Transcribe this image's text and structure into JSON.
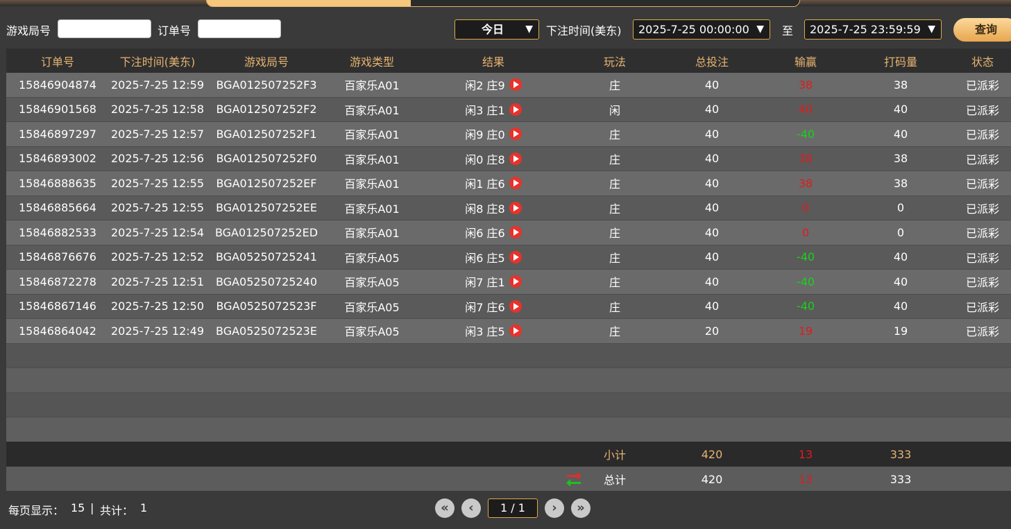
{
  "filter": {
    "round_label": "游戏局号",
    "round_value": "",
    "order_label": "订单号",
    "order_value": "",
    "range_value": "今日",
    "bet_time_label": "下注时间(美东)",
    "start_time": "2025-7-25 00:00:00",
    "to_label": "至",
    "end_time": "2025-7-25 23:59:59",
    "query_label": "查询"
  },
  "table": {
    "headers": [
      "订单号",
      "下注时间(美东)",
      "游戏局号",
      "游戏类型",
      "结果",
      "玩法",
      "总投注",
      "输赢",
      "打码量",
      "状态"
    ],
    "rows": [
      {
        "order": "15846904874",
        "time": "2025-7-25 12:59",
        "round": "BGA012507252F3",
        "game": "百家乐A01",
        "result": "闲2 庄9",
        "play": "庄",
        "bet": "40",
        "win": "38",
        "win_color": "red",
        "code": "38",
        "status": "已派彩"
      },
      {
        "order": "15846901568",
        "time": "2025-7-25 12:58",
        "round": "BGA012507252F2",
        "game": "百家乐A01",
        "result": "闲3 庄1",
        "play": "闲",
        "bet": "40",
        "win": "40",
        "win_color": "red",
        "code": "40",
        "status": "已派彩"
      },
      {
        "order": "15846897297",
        "time": "2025-7-25 12:57",
        "round": "BGA012507252F1",
        "game": "百家乐A01",
        "result": "闲9 庄0",
        "play": "庄",
        "bet": "40",
        "win": "-40",
        "win_color": "green",
        "code": "40",
        "status": "已派彩"
      },
      {
        "order": "15846893002",
        "time": "2025-7-25 12:56",
        "round": "BGA012507252F0",
        "game": "百家乐A01",
        "result": "闲0 庄8",
        "play": "庄",
        "bet": "40",
        "win": "38",
        "win_color": "red",
        "code": "38",
        "status": "已派彩"
      },
      {
        "order": "15846888635",
        "time": "2025-7-25 12:55",
        "round": "BGA012507252EF",
        "game": "百家乐A01",
        "result": "闲1 庄6",
        "play": "庄",
        "bet": "40",
        "win": "38",
        "win_color": "red",
        "code": "38",
        "status": "已派彩"
      },
      {
        "order": "15846885664",
        "time": "2025-7-25 12:55",
        "round": "BGA012507252EE",
        "game": "百家乐A01",
        "result": "闲8 庄8",
        "play": "庄",
        "bet": "40",
        "win": "0",
        "win_color": "red",
        "code": "0",
        "status": "已派彩"
      },
      {
        "order": "15846882533",
        "time": "2025-7-25 12:54",
        "round": "BGA012507252ED",
        "game": "百家乐A01",
        "result": "闲6 庄6",
        "play": "庄",
        "bet": "40",
        "win": "0",
        "win_color": "red",
        "code": "0",
        "status": "已派彩"
      },
      {
        "order": "15846876676",
        "time": "2025-7-25 12:52",
        "round": "BGA05250725241",
        "game": "百家乐A05",
        "result": "闲6 庄5",
        "play": "庄",
        "bet": "40",
        "win": "-40",
        "win_color": "green",
        "code": "40",
        "status": "已派彩"
      },
      {
        "order": "15846872278",
        "time": "2025-7-25 12:51",
        "round": "BGA05250725240",
        "game": "百家乐A05",
        "result": "闲7 庄1",
        "play": "庄",
        "bet": "40",
        "win": "-40",
        "win_color": "green",
        "code": "40",
        "status": "已派彩"
      },
      {
        "order": "15846867146",
        "time": "2025-7-25 12:50",
        "round": "BGA0525072523F",
        "game": "百家乐A05",
        "result": "闲7 庄6",
        "play": "庄",
        "bet": "40",
        "win": "-40",
        "win_color": "green",
        "code": "40",
        "status": "已派彩"
      },
      {
        "order": "15846864042",
        "time": "2025-7-25 12:49",
        "round": "BGA0525072523E",
        "game": "百家乐A05",
        "result": "闲3 庄5",
        "play": "庄",
        "bet": "20",
        "win": "19",
        "win_color": "red",
        "code": "19",
        "status": "已派彩"
      }
    ]
  },
  "subtotal": {
    "label": "小计",
    "bet": "420",
    "win": "13",
    "code": "333"
  },
  "total": {
    "label": "总计",
    "bet": "420",
    "win": "13",
    "code": "333"
  },
  "footer": {
    "per_page_label": "每页显示：",
    "per_page": "15",
    "sep": "|",
    "count_label": "共计：",
    "count": "1",
    "page_display": "1 / 1"
  },
  "colors": {
    "accent": "#e7b371",
    "win_red": "#e21b1b",
    "win_green": "#19d219"
  }
}
